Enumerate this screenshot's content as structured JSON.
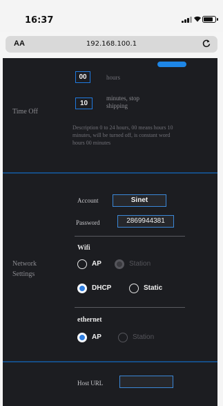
{
  "status_bar": {
    "time": "16:37"
  },
  "address_bar": {
    "aa_label": "AA",
    "url": "192.168.100.1",
    "reload_icon": "reload-icon"
  },
  "timeout": {
    "section_label": "Time Off",
    "hours_value": "00",
    "hours_unit": "hours",
    "minutes_value": "10",
    "minutes_unit": "minutes, stop",
    "minutes_unit2": "shipping",
    "description": "Description 0 to 24 hours, 00 means hours 10 minutes, will be turned off, is constant word hours 00 minutes"
  },
  "network": {
    "section_label_line1": "Network",
    "section_label_line2": "Settings",
    "account_label": "Account",
    "account_value": "Sinet",
    "password_label": "Password",
    "password_value": "2869944381",
    "wifi_title": "Wifi",
    "wifi_modes": [
      {
        "label": "AP",
        "checked": false,
        "enabled": true
      },
      {
        "label": "Station",
        "checked": true,
        "enabled": false
      }
    ],
    "ip_modes": [
      {
        "label": "DHCP",
        "checked": true,
        "enabled": true
      },
      {
        "label": "Static",
        "checked": false,
        "enabled": true
      }
    ],
    "ethernet_title": "ethernet",
    "ethernet_modes": [
      {
        "label": "AP",
        "checked": true,
        "enabled": true
      },
      {
        "label": "Station",
        "checked": false,
        "enabled": false
      }
    ]
  },
  "host": {
    "label": "Host URL",
    "value": ""
  },
  "colors": {
    "accent": "#1f7ae0",
    "separator": "#164d86",
    "background": "#1c1d21"
  }
}
